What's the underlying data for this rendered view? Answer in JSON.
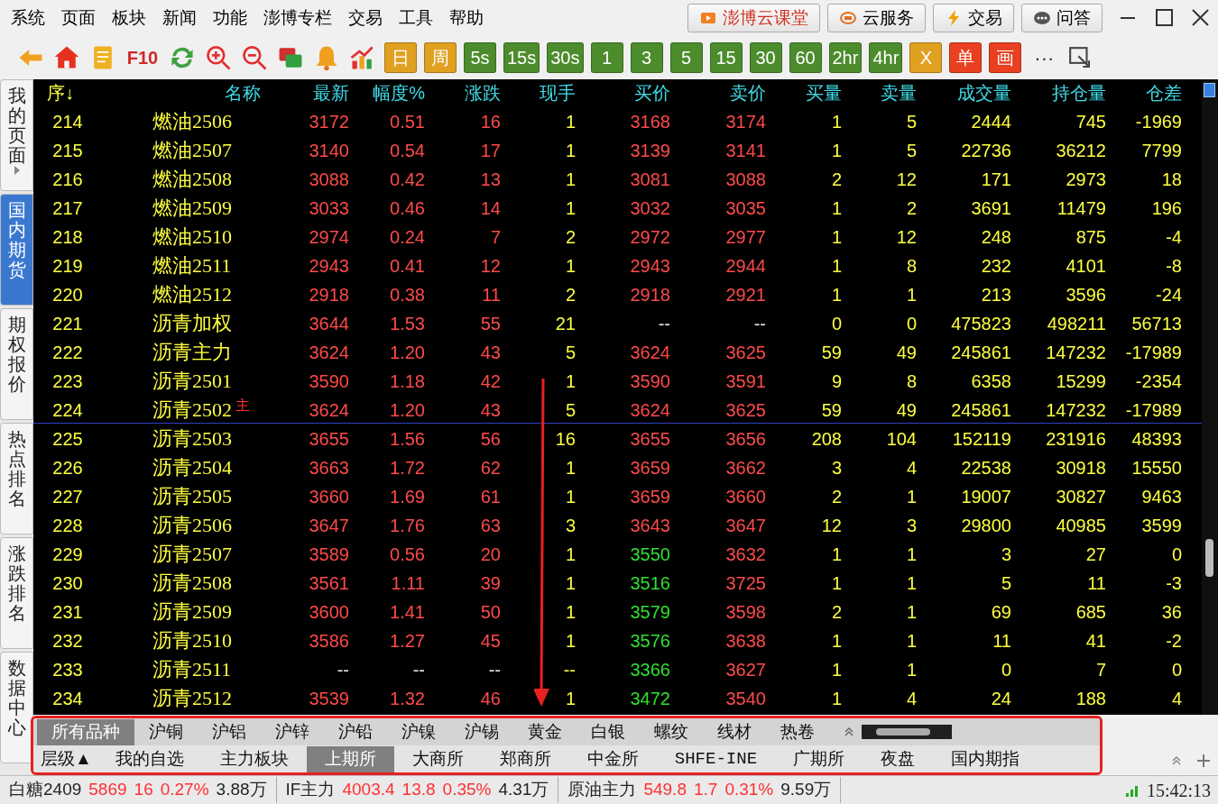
{
  "menu": [
    "系统",
    "页面",
    "板块",
    "新闻",
    "功能",
    "澎博专栏",
    "交易",
    "工具",
    "帮助"
  ],
  "top_buttons": [
    "澎博云课堂",
    "云服务",
    "交易",
    "问答"
  ],
  "toolbar": {
    "f10": "F10",
    "buttons": [
      {
        "label": "日",
        "color": "#e0a020"
      },
      {
        "label": "周",
        "color": "#e0a020"
      },
      {
        "label": "5s",
        "color": "#4c8c2c"
      },
      {
        "label": "15s",
        "color": "#4c8c2c"
      },
      {
        "label": "30s",
        "color": "#4c8c2c"
      },
      {
        "label": "1",
        "color": "#4c8c2c"
      },
      {
        "label": "3",
        "color": "#4c8c2c"
      },
      {
        "label": "5",
        "color": "#4c8c2c"
      },
      {
        "label": "15",
        "color": "#4c8c2c"
      },
      {
        "label": "30",
        "color": "#4c8c2c"
      },
      {
        "label": "60",
        "color": "#4c8c2c"
      },
      {
        "label": "2hr",
        "color": "#4c8c2c"
      },
      {
        "label": "4hr",
        "color": "#4c8c2c"
      },
      {
        "label": "X",
        "color": "#e0a020"
      },
      {
        "label": "单",
        "color": "#e84020"
      },
      {
        "label": "画",
        "color": "#e84020"
      }
    ],
    "more": "···"
  },
  "sidebar": [
    {
      "label": "我的页面",
      "selected": false,
      "expandable": true
    },
    {
      "label": "国内期货",
      "selected": true,
      "expandable": false
    },
    {
      "label": "期权报价",
      "selected": false,
      "expandable": false
    },
    {
      "label": "热点排名",
      "selected": false,
      "expandable": false
    },
    {
      "label": "涨跌排名",
      "selected": false,
      "expandable": false
    },
    {
      "label": "数据中心",
      "selected": false,
      "expandable": false
    }
  ],
  "table": {
    "columns": [
      "序↓",
      "名称",
      "最新",
      "幅度%",
      "涨跌",
      "现手",
      "买价",
      "卖价",
      "买量",
      "卖量",
      "成交量",
      "持仓量",
      "仓差"
    ],
    "rows": [
      {
        "cells": [
          "214",
          "燃油2506",
          "3172",
          "0.51",
          "16",
          "1",
          "3168",
          "3174",
          "1",
          "5",
          "2444",
          "745",
          "-1969"
        ]
      },
      {
        "cells": [
          "215",
          "燃油2507",
          "3140",
          "0.54",
          "17",
          "1",
          "3139",
          "3141",
          "1",
          "5",
          "22736",
          "36212",
          "7799"
        ]
      },
      {
        "cells": [
          "216",
          "燃油2508",
          "3088",
          "0.42",
          "13",
          "1",
          "3081",
          "3088",
          "2",
          "12",
          "171",
          "2973",
          "18"
        ]
      },
      {
        "cells": [
          "217",
          "燃油2509",
          "3033",
          "0.46",
          "14",
          "1",
          "3032",
          "3035",
          "1",
          "2",
          "3691",
          "11479",
          "196"
        ]
      },
      {
        "cells": [
          "218",
          "燃油2510",
          "2974",
          "0.24",
          "7",
          "2",
          "2972",
          "2977",
          "1",
          "12",
          "248",
          "875",
          "-4"
        ]
      },
      {
        "cells": [
          "219",
          "燃油2511",
          "2943",
          "0.41",
          "12",
          "1",
          "2943",
          "2944",
          "1",
          "8",
          "232",
          "4101",
          "-8"
        ]
      },
      {
        "cells": [
          "220",
          "燃油2512",
          "2918",
          "0.38",
          "11",
          "2",
          "2918",
          "2921",
          "1",
          "1",
          "213",
          "3596",
          "-24"
        ]
      },
      {
        "cells": [
          "221",
          "沥青加权",
          "3644",
          "1.53",
          "55",
          "21",
          "--",
          "--",
          "0",
          "0",
          "475823",
          "498211",
          "56713"
        ]
      },
      {
        "cells": [
          "222",
          "沥青主力",
          "3624",
          "1.20",
          "43",
          "5",
          "3624",
          "3625",
          "59",
          "49",
          "245861",
          "147232",
          "-17989"
        ]
      },
      {
        "cells": [
          "223",
          "沥青2501",
          "3590",
          "1.18",
          "42",
          "1",
          "3590",
          "3591",
          "9",
          "8",
          "6358",
          "15299",
          "-2354"
        ]
      },
      {
        "cells": [
          "224",
          "沥青2502",
          "3624",
          "1.20",
          "43",
          "5",
          "3624",
          "3625",
          "59",
          "49",
          "245861",
          "147232",
          "-17989"
        ],
        "tag": "主"
      },
      {
        "cells": [
          "225",
          "沥青2503",
          "3655",
          "1.56",
          "56",
          "16",
          "3655",
          "3656",
          "208",
          "104",
          "152119",
          "231916",
          "48393"
        ]
      },
      {
        "cells": [
          "226",
          "沥青2504",
          "3663",
          "1.72",
          "62",
          "1",
          "3659",
          "3662",
          "3",
          "4",
          "22538",
          "30918",
          "15550"
        ]
      },
      {
        "cells": [
          "227",
          "沥青2505",
          "3660",
          "1.69",
          "61",
          "1",
          "3659",
          "3660",
          "2",
          "1",
          "19007",
          "30827",
          "9463"
        ]
      },
      {
        "cells": [
          "228",
          "沥青2506",
          "3647",
          "1.76",
          "63",
          "3",
          "3643",
          "3647",
          "12",
          "3",
          "29800",
          "40985",
          "3599"
        ]
      },
      {
        "cells": [
          "229",
          "沥青2507",
          "3589",
          "0.56",
          "20",
          "1",
          "3550",
          "3632",
          "1",
          "1",
          "3",
          "27",
          "0"
        ]
      },
      {
        "cells": [
          "230",
          "沥青2508",
          "3561",
          "1.11",
          "39",
          "1",
          "3516",
          "3725",
          "1",
          "1",
          "5",
          "11",
          "-3"
        ]
      },
      {
        "cells": [
          "231",
          "沥青2509",
          "3600",
          "1.41",
          "50",
          "1",
          "3579",
          "3598",
          "2",
          "1",
          "69",
          "685",
          "36"
        ]
      },
      {
        "cells": [
          "232",
          "沥青2510",
          "3586",
          "1.27",
          "45",
          "1",
          "3576",
          "3638",
          "1",
          "1",
          "11",
          "41",
          "-2"
        ]
      },
      {
        "cells": [
          "233",
          "沥青2511",
          "--",
          "--",
          "--",
          "--",
          "3366",
          "3627",
          "1",
          "1",
          "0",
          "7",
          "0"
        ]
      },
      {
        "cells": [
          "234",
          "沥青2512",
          "3539",
          "1.32",
          "46",
          "1",
          "3472",
          "3540",
          "1",
          "4",
          "24",
          "188",
          "4"
        ]
      }
    ]
  },
  "row_styles": [
    {
      "price": {
        "color": "#ff4a4a"
      },
      "bid": {
        "color": "#ff4a4a"
      },
      "ask": {
        "color": "#ff4a4a"
      },
      "divider": false
    },
    {
      "price": {
        "color": "#ff4a4a"
      },
      "bid": {
        "color": "#ff4a4a"
      },
      "ask": {
        "color": "#ff4a4a"
      },
      "divider": false
    },
    {
      "price": {
        "color": "#ff4a4a"
      },
      "bid": {
        "color": "#ff4a4a"
      },
      "ask": {
        "color": "#ff4a4a"
      },
      "divider": false
    },
    {
      "price": {
        "color": "#ff4a4a"
      },
      "bid": {
        "color": "#ff4a4a"
      },
      "ask": {
        "color": "#ff4a4a"
      },
      "divider": false
    },
    {
      "price": {
        "color": "#ff4a4a"
      },
      "bid": {
        "color": "#ff4a4a"
      },
      "ask": {
        "color": "#ff4a4a"
      },
      "divider": false
    },
    {
      "price": {
        "color": "#ff4a4a"
      },
      "bid": {
        "color": "#ff4a4a"
      },
      "ask": {
        "color": "#ff4a4a"
      },
      "divider": false
    },
    {
      "price": {
        "color": "#ff4a4a"
      },
      "bid": {
        "color": "#ff4a4a"
      },
      "ask": {
        "color": "#ff4a4a"
      },
      "divider": false
    },
    {
      "price": {
        "color": "#ff4a4a"
      },
      "bid": {
        "color": "#e8e8e8"
      },
      "ask": {
        "color": "#e8e8e8"
      },
      "divider": false
    },
    {
      "price": {
        "color": "#ff4a4a"
      },
      "bid": {
        "color": "#ff4a4a"
      },
      "ask": {
        "color": "#ff4a4a"
      },
      "divider": false
    },
    {
      "price": {
        "color": "#ff4a4a"
      },
      "bid": {
        "color": "#ff4a4a"
      },
      "ask": {
        "color": "#ff4a4a"
      },
      "divider": false
    },
    {
      "price": {
        "color": "#ff4a4a"
      },
      "bid": {
        "color": "#ff4a4a"
      },
      "ask": {
        "color": "#ff4a4a"
      },
      "divider": true
    },
    {
      "price": {
        "color": "#ff4a4a"
      },
      "bid": {
        "color": "#ff4a4a"
      },
      "ask": {
        "color": "#ff4a4a"
      },
      "divider": false
    },
    {
      "price": {
        "color": "#ff4a4a"
      },
      "bid": {
        "color": "#ff4a4a"
      },
      "ask": {
        "color": "#ff4a4a"
      },
      "divider": false
    },
    {
      "price": {
        "color": "#ff4a4a"
      },
      "bid": {
        "color": "#ff4a4a"
      },
      "ask": {
        "color": "#ff4a4a"
      },
      "divider": false
    },
    {
      "price": {
        "color": "#ff4a4a"
      },
      "bid": {
        "color": "#ff4a4a"
      },
      "ask": {
        "color": "#ff4a4a"
      },
      "divider": false
    },
    {
      "price": {
        "color": "#ff4a4a"
      },
      "bid": {
        "color": "#30e030"
      },
      "ask": {
        "color": "#ff4a4a"
      },
      "divider": false
    },
    {
      "price": {
        "color": "#ff4a4a"
      },
      "bid": {
        "color": "#30e030"
      },
      "ask": {
        "color": "#ff4a4a"
      },
      "divider": false
    },
    {
      "price": {
        "color": "#ff4a4a"
      },
      "bid": {
        "color": "#30e030"
      },
      "ask": {
        "color": "#ff4a4a"
      },
      "divider": false
    },
    {
      "price": {
        "color": "#ff4a4a"
      },
      "bid": {
        "color": "#30e030"
      },
      "ask": {
        "color": "#ff4a4a"
      },
      "divider": false
    },
    {
      "price": {
        "color": "#e8e8e8"
      },
      "bid": {
        "color": "#30e030"
      },
      "ask": {
        "color": "#ff4a4a"
      },
      "divider": false
    },
    {
      "price": {
        "color": "#ff4a4a"
      },
      "bid": {
        "color": "#30e030"
      },
      "ask": {
        "color": "#ff4a4a"
      },
      "divider": false
    }
  ],
  "category_tabs": [
    {
      "label": "所有品种",
      "selected": true
    },
    {
      "label": "沪铜",
      "selected": false
    },
    {
      "label": "沪铝",
      "selected": false
    },
    {
      "label": "沪锌",
      "selected": false
    },
    {
      "label": "沪铅",
      "selected": false
    },
    {
      "label": "沪镍",
      "selected": false
    },
    {
      "label": "沪锡",
      "selected": false
    },
    {
      "label": "黄金",
      "selected": false
    },
    {
      "label": "白银",
      "selected": false
    },
    {
      "label": "螺纹",
      "selected": false
    },
    {
      "label": "线材",
      "selected": false
    },
    {
      "label": "热卷",
      "selected": false
    }
  ],
  "exchange_tabs": [
    {
      "label": "层级▲",
      "selected": false
    },
    {
      "label": "我的自选",
      "selected": false
    },
    {
      "label": "主力板块",
      "selected": false
    },
    {
      "label": "上期所",
      "selected": true
    },
    {
      "label": "大商所",
      "selected": false
    },
    {
      "label": "郑商所",
      "selected": false
    },
    {
      "label": "中金所",
      "selected": false
    },
    {
      "label": "SHFE-INE",
      "selected": false
    },
    {
      "label": "广期所",
      "selected": false
    },
    {
      "label": "夜盘",
      "selected": false
    },
    {
      "label": "国内期指",
      "selected": false
    }
  ],
  "status_bar": {
    "quotes": [
      {
        "name": "白糖2409",
        "price": "5869",
        "change": "16",
        "pct": "0.27%",
        "volume": "3.88万"
      },
      {
        "name": "IF主力",
        "price": "4003.4",
        "change": "13.8",
        "pct": "0.35%",
        "volume": "4.31万"
      },
      {
        "name": "原油主力",
        "price": "549.8",
        "change": "1.7",
        "pct": "0.31%",
        "volume": "9.59万"
      }
    ],
    "time": "15:42:13"
  }
}
